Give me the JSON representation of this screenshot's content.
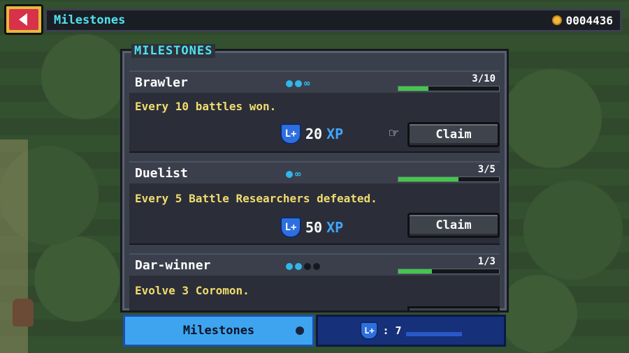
{
  "header": {
    "title": "Milestones",
    "gold": "0004436"
  },
  "panel": {
    "title": "MILESTONES"
  },
  "milestones": [
    {
      "name": "Brawler",
      "desc": "Every 10 battles won.",
      "progress": "3/10",
      "progress_fraction": 0.3,
      "reward": "20",
      "reward_unit": "XP",
      "claim_label": "Claim",
      "tier_dots": [
        "on",
        "on",
        "infinity"
      ]
    },
    {
      "name": "Duelist",
      "desc": "Every 5 Battle Researchers defeated.",
      "progress": "3/5",
      "progress_fraction": 0.6,
      "reward": "50",
      "reward_unit": "XP",
      "claim_label": "Claim",
      "tier_dots": [
        "on",
        "infinity"
      ]
    },
    {
      "name": "Dar-winner",
      "desc": "Evolve 3 Coromon.",
      "progress": "1/3",
      "progress_fraction": 0.33,
      "tier_dots": [
        "on",
        "on",
        "off",
        "off"
      ]
    }
  ],
  "tabs": {
    "milestones_label": "Milestones",
    "xp_count": ": 7"
  },
  "colors": {
    "accent_cyan": "#4ee3f0",
    "desc_yellow": "#f1dc6f",
    "xp_blue": "#3fa6ff",
    "progress_green": "#43c74a"
  }
}
